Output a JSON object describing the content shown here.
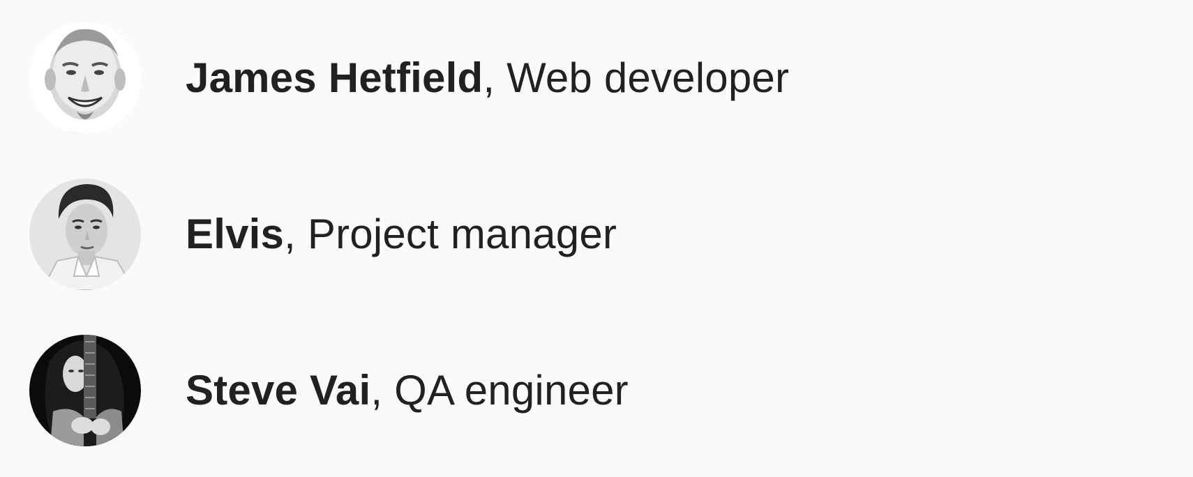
{
  "people": [
    {
      "name": "James Hetfield",
      "separator": ", ",
      "role": "Web developer"
    },
    {
      "name": "Elvis",
      "separator": ", ",
      "role": "Project manager"
    },
    {
      "name": "Steve Vai",
      "separator": ", ",
      "role": "QA engineer"
    }
  ]
}
